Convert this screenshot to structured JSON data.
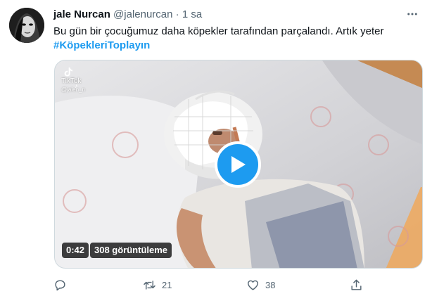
{
  "tweet": {
    "author_name": "jale Nurcan",
    "handle": "@jalenurcan",
    "separator": "·",
    "time": "1 sa",
    "text": "Bu gün bir çocuğumuz daha köpekler tarafından parçalandı. Artık yeter",
    "hashtag": "#KöpekleriToplayın"
  },
  "video": {
    "watermark_brand": "TikTok",
    "watermark_user": "@jalen_n",
    "duration": "0:42",
    "views": "308 görüntüleme"
  },
  "actions": {
    "reply_count": "",
    "retweet_count": "21",
    "like_count": "38"
  },
  "colors": {
    "accent": "#1d9bf0",
    "text_primary": "#0f1419",
    "text_secondary": "#536471"
  }
}
